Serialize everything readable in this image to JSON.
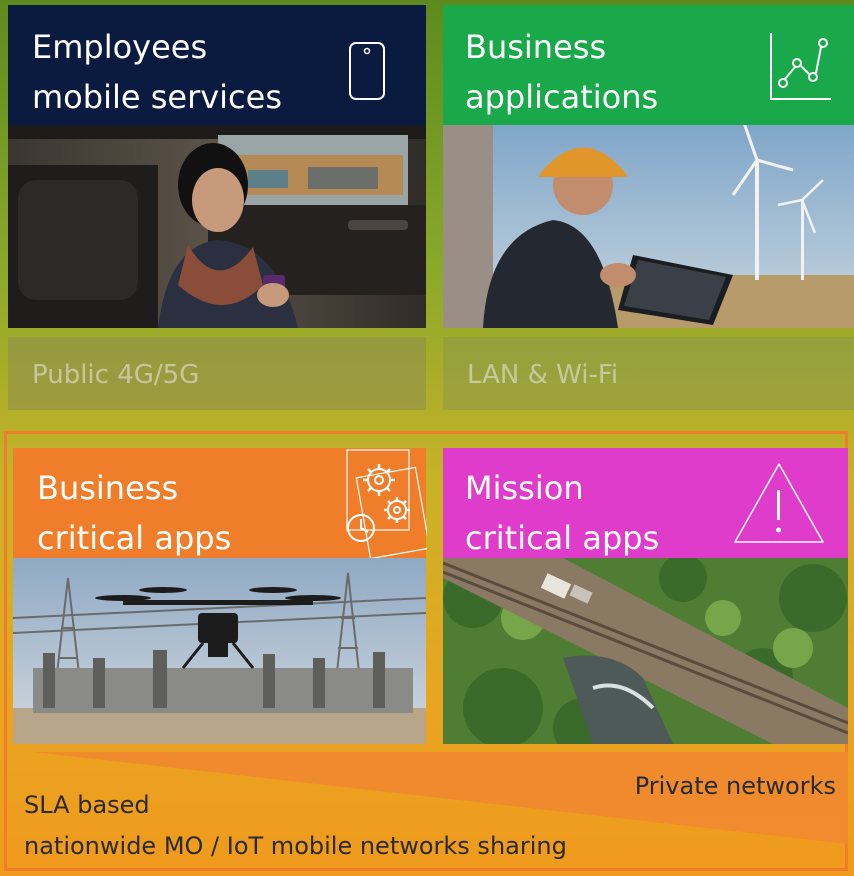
{
  "top_left": {
    "title_line1": "Employees",
    "title_line2": "mobile services",
    "icon": "smartphone-icon",
    "network": "Public 4G/5G",
    "color": "#0b1a3f"
  },
  "top_right": {
    "title_line1": "Business",
    "title_line2": "applications",
    "icon": "chart-icon",
    "network": "LAN & Wi-Fi",
    "color": "#19a84a"
  },
  "bottom_left": {
    "title_line1": "Business",
    "title_line2": "critical apps",
    "icon": "gears-clock-icon",
    "color": "#f07d2a"
  },
  "bottom_right": {
    "title_line1": "Mission",
    "title_line2": "critical apps",
    "icon": "warning-icon",
    "color": "#df3ccb"
  },
  "footer": {
    "private_networks": "Private networks",
    "sla_line1": "SLA based",
    "sla_line2": "nationwide MO / IoT mobile networks sharing"
  }
}
